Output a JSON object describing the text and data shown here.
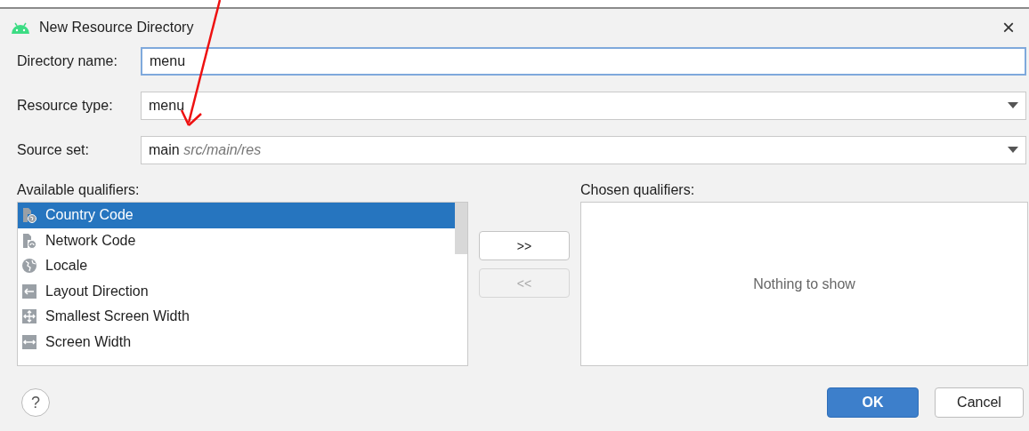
{
  "window": {
    "title": "New Resource Directory",
    "close": "×"
  },
  "fields": [
    {
      "kind": "text",
      "label": "Directory name:",
      "value": "menu",
      "focused": true
    },
    {
      "kind": "dropdown",
      "label": "Resource type:",
      "value": "menu",
      "focused": false
    },
    {
      "kind": "dropdown",
      "label": "Source set:",
      "value": "main",
      "hint": "src/main/res",
      "focused": false
    }
  ],
  "available": {
    "label": "Available qualifiers:",
    "items": [
      {
        "kind": "country",
        "label": "Country Code",
        "selected": true
      },
      {
        "kind": "network",
        "label": "Network Code",
        "selected": false
      },
      {
        "kind": "locale",
        "label": "Locale",
        "selected": false
      },
      {
        "kind": "direction",
        "label": "Layout Direction",
        "selected": false
      },
      {
        "kind": "smallest-width",
        "label": "Smallest Screen Width",
        "selected": false
      },
      {
        "kind": "width",
        "label": "Screen Width",
        "selected": false
      }
    ]
  },
  "move_buttons": [
    {
      "label": ">>",
      "disabled": false
    },
    {
      "label": "<<",
      "disabled": true
    }
  ],
  "chosen": {
    "label": "Chosen qualifiers:",
    "empty_text": "Nothing to show"
  },
  "footer": {
    "help": "?",
    "buttons": [
      {
        "label": "OK",
        "primary": true
      },
      {
        "label": "Cancel",
        "primary": false
      }
    ]
  }
}
